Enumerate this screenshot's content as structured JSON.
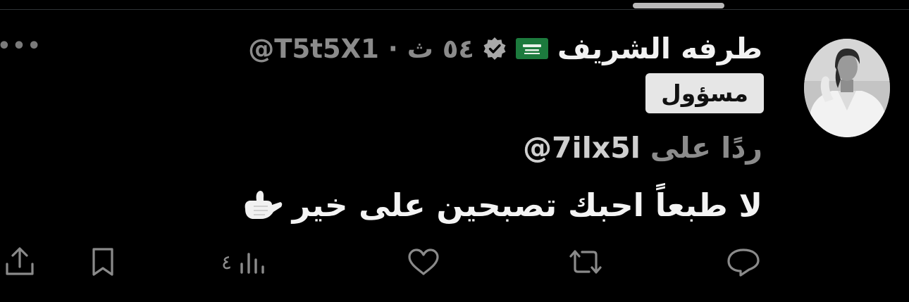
{
  "tweet": {
    "display_name": "طرفه الشريف",
    "handle_time": "@T5t5X1 · ٥٤ ث",
    "role_badge": "مسؤول",
    "reply_prefix": "ردًا على",
    "reply_to": "@7ilx5l",
    "text": "لا طبعاً احبك تصبحين على خير",
    "views_count": "٤"
  },
  "icons": {
    "flag": "saudi-flag-icon",
    "verified": "verified-badge-icon",
    "more": "more-options-icon",
    "emoji": "call-me-hand-emoji",
    "reply": "reply-icon",
    "retweet": "retweet-icon",
    "like": "like-icon",
    "views": "views-icon",
    "bookmark": "bookmark-icon",
    "share": "share-icon"
  },
  "colors": {
    "background": "#000000",
    "primary_text": "#f2f2f2",
    "secondary_text": "#8b8b8b",
    "badge_bg": "#e6e6e6",
    "flag_green": "#1c7a3d",
    "action_icon": "#8a8a8a"
  }
}
